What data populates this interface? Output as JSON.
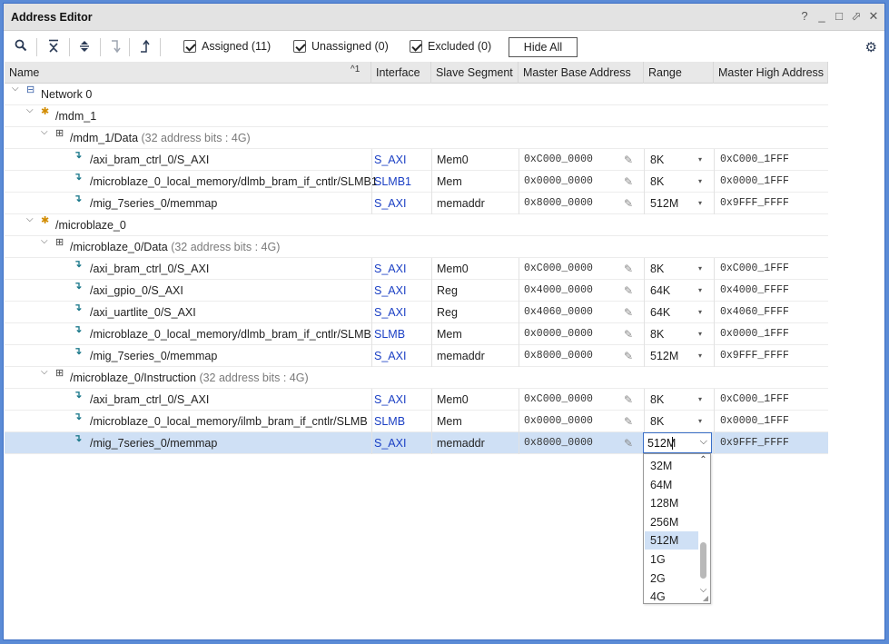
{
  "window": {
    "title": "Address Editor",
    "controls": [
      "?",
      "_",
      "□",
      "⬀",
      "✕"
    ]
  },
  "toolbar": {
    "icons": [
      "search-icon",
      "collapse-all-icon",
      "expand-all-icon",
      "move-down-icon",
      "move-up-icon"
    ],
    "checks": [
      {
        "label": "Assigned (11)",
        "checked": true
      },
      {
        "label": "Unassigned (0)",
        "checked": true
      },
      {
        "label": "Excluded (0)",
        "checked": true
      }
    ],
    "hide_all_label": "Hide All",
    "settings_icon": "gear-icon"
  },
  "columns": {
    "name": "Name",
    "sort_indicator": "^1",
    "interface": "Interface",
    "slave_segment": "Slave Segment",
    "master_base": "Master Base Address",
    "range": "Range",
    "master_high": "Master High Address"
  },
  "tree": {
    "network": "Network 0",
    "mdm": {
      "label": "/mdm_1",
      "space_label": "/mdm_1/Data",
      "space_note": "(32 address bits : 4G)",
      "rows": [
        {
          "name": "/axi_bram_ctrl_0/S_AXI",
          "interface": "S_AXI",
          "segment": "Mem0",
          "base": "0xC000_0000",
          "range": "8K",
          "high": "0xC000_1FFF"
        },
        {
          "name": "/microblaze_0_local_memory/dlmb_bram_if_cntlr/SLMB1",
          "interface": "SLMB1",
          "segment": "Mem",
          "base": "0x0000_0000",
          "range": "8K",
          "high": "0x0000_1FFF"
        },
        {
          "name": "/mig_7series_0/memmap",
          "interface": "S_AXI",
          "segment": "memaddr",
          "base": "0x8000_0000",
          "range": "512M",
          "high": "0x9FFF_FFFF"
        }
      ]
    },
    "microblaze": {
      "label": "/microblaze_0",
      "data_label": "/microblaze_0/Data",
      "data_note": "(32 address bits : 4G)",
      "data_rows": [
        {
          "name": "/axi_bram_ctrl_0/S_AXI",
          "interface": "S_AXI",
          "segment": "Mem0",
          "base": "0xC000_0000",
          "range": "8K",
          "high": "0xC000_1FFF"
        },
        {
          "name": "/axi_gpio_0/S_AXI",
          "interface": "S_AXI",
          "segment": "Reg",
          "base": "0x4000_0000",
          "range": "64K",
          "high": "0x4000_FFFF"
        },
        {
          "name": "/axi_uartlite_0/S_AXI",
          "interface": "S_AXI",
          "segment": "Reg",
          "base": "0x4060_0000",
          "range": "64K",
          "high": "0x4060_FFFF"
        },
        {
          "name": "/microblaze_0_local_memory/dlmb_bram_if_cntlr/SLMB",
          "interface": "SLMB",
          "segment": "Mem",
          "base": "0x0000_0000",
          "range": "8K",
          "high": "0x0000_1FFF"
        },
        {
          "name": "/mig_7series_0/memmap",
          "interface": "S_AXI",
          "segment": "memaddr",
          "base": "0x8000_0000",
          "range": "512M",
          "high": "0x9FFF_FFFF"
        }
      ],
      "instr_label": "/microblaze_0/Instruction",
      "instr_note": "(32 address bits : 4G)",
      "instr_rows": [
        {
          "name": "/axi_bram_ctrl_0/S_AXI",
          "interface": "S_AXI",
          "segment": "Mem0",
          "base": "0xC000_0000",
          "range": "8K",
          "high": "0xC000_1FFF"
        },
        {
          "name": "/microblaze_0_local_memory/ilmb_bram_if_cntlr/SLMB",
          "interface": "SLMB",
          "segment": "Mem",
          "base": "0x0000_0000",
          "range": "8K",
          "high": "0x0000_1FFF"
        },
        {
          "name": "/mig_7series_0/memmap",
          "interface": "S_AXI",
          "segment": "memaddr",
          "base": "0x8000_0000",
          "range": "512M",
          "high": "0x9FFF_FFFF"
        }
      ]
    }
  },
  "range_editor": {
    "value": "512M",
    "options": [
      "32M",
      "64M",
      "128M",
      "256M",
      "512M",
      "1G",
      "2G",
      "4G"
    ],
    "selected": "512M"
  },
  "colors": {
    "window_border": "#3d6fc4",
    "selection": "#cfe0f5",
    "link": "#1a3fc4"
  }
}
